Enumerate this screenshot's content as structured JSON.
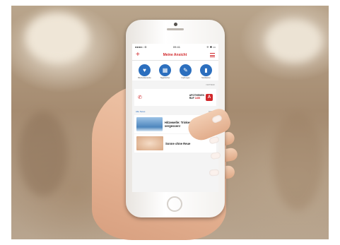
{
  "status_bar": {
    "time": "09:41",
    "left": "●●●●○ ⊛",
    "right": "✈ ✱ ▭"
  },
  "nav": {
    "title": "Meine Ansicht",
    "add_icon": "plus-icon",
    "menu_icon": "hamburger-icon"
  },
  "shortcuts": [
    {
      "icon": "bottle-icon",
      "glyph": "▮",
      "label": "Medikation"
    },
    {
      "icon": "syringe-icon",
      "glyph": "✎",
      "label": "Impfungen"
    },
    {
      "icon": "calendar-icon",
      "glyph": "▦",
      "label": "Tagebücher"
    },
    {
      "icon": "heart-pulse-icon",
      "glyph": "♥",
      "label": "Blutzuckerwerte"
    }
  ],
  "notfall": {
    "header": "NOTRUF",
    "logo_line1": "APOTHEKEN",
    "logo_line2": "RUF",
    "logo_number": "1455",
    "phone_icon": "phone-icon"
  },
  "news": {
    "header": "NEWS",
    "all_link": "Alle News",
    "items": [
      {
        "title": "Hitzewelle: Trinken nicht vergessen!",
        "thumb": "water-glass"
      },
      {
        "title": "Sonne ohne Reue",
        "thumb": "skin"
      }
    ]
  },
  "colors": {
    "accent": "#d1272a",
    "icon_blue": "#2c6fbe"
  }
}
